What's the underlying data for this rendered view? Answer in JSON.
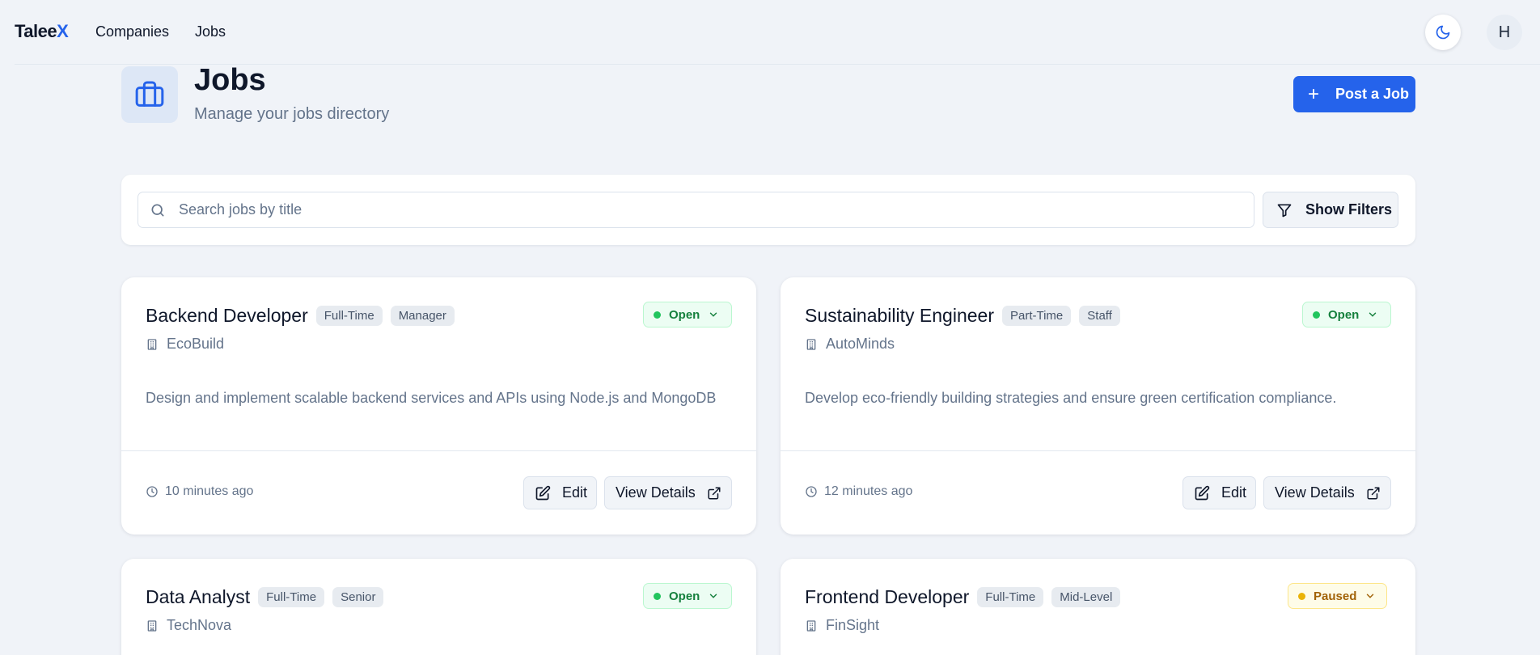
{
  "nav": {
    "brand_main": "Talee",
    "brand_accent": "X",
    "links": [
      "Companies",
      "Jobs"
    ],
    "theme_icon": "moon-icon",
    "avatar_initial": "H"
  },
  "header": {
    "icon": "briefcase-icon",
    "title": "Jobs",
    "subtitle": "Manage your jobs directory",
    "post_button": "Post a Job"
  },
  "search": {
    "placeholder": "Search jobs by title",
    "value": "",
    "filters_button": "Show Filters"
  },
  "colors": {
    "accent": "#2563eb",
    "background": "#f0f3f8",
    "open": "#22c55e",
    "paused": "#eab308"
  },
  "jobs": [
    {
      "title": "Backend Developer",
      "type": "Full-Time",
      "level": "Manager",
      "status": "Open",
      "company": "EcoBuild",
      "description": "Design and implement scalable backend services and APIs using Node.js and MongoDB",
      "posted": "10 minutes ago",
      "edit_label": "Edit",
      "view_label": "View Details"
    },
    {
      "title": "Sustainability Engineer",
      "type": "Part-Time",
      "level": "Staff",
      "status": "Open",
      "company": "AutoMinds",
      "description": "Develop eco-friendly building strategies and ensure green certification compliance.",
      "posted": "12 minutes ago",
      "edit_label": "Edit",
      "view_label": "View Details"
    },
    {
      "title": "Data Analyst",
      "type": "Full-Time",
      "level": "Senior",
      "status": "Open",
      "company": "TechNova"
    },
    {
      "title": "Frontend Developer",
      "type": "Full-Time",
      "level": "Mid-Level",
      "status": "Paused",
      "company": "FinSight"
    }
  ]
}
